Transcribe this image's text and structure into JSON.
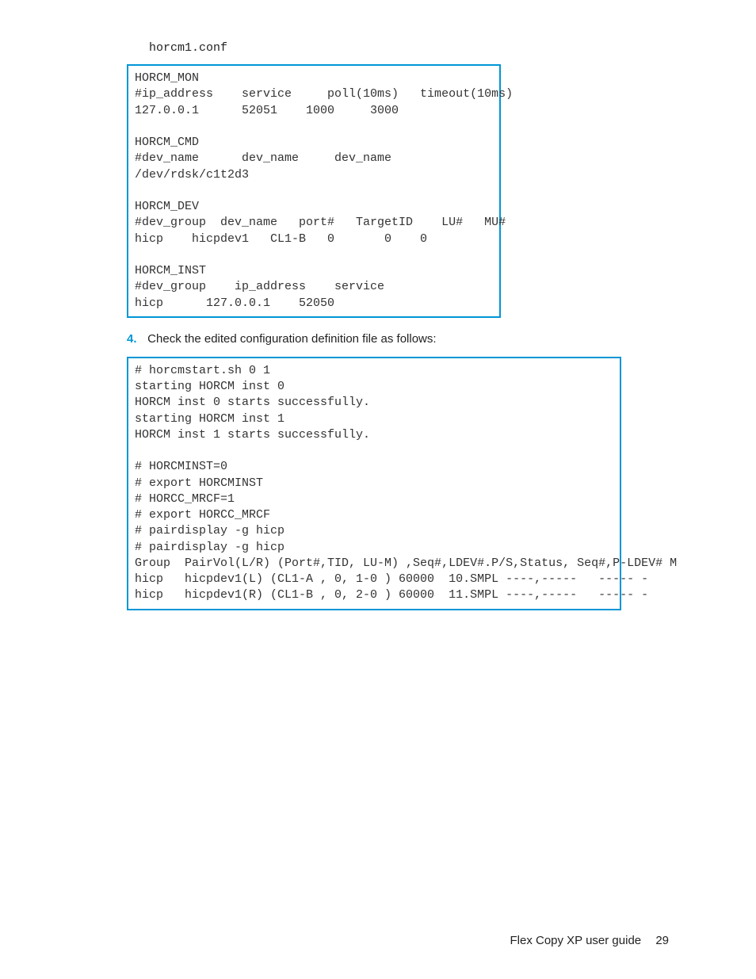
{
  "file_label": "horcm1.conf",
  "code_block_1": "HORCM_MON\n#ip_address    service     poll(10ms)   timeout(10ms)\n127.0.0.1      52051    1000     3000\n\nHORCM_CMD\n#dev_name      dev_name     dev_name\n/dev/rdsk/c1t2d3\n\nHORCM_DEV\n#dev_group  dev_name   port#   TargetID    LU#   MU#\nhicp    hicpdev1   CL1-B   0       0    0\n\nHORCM_INST\n#dev_group    ip_address    service\nhicp      127.0.0.1    52050",
  "step": {
    "number": "4.",
    "text": "Check the edited configuration definition file as follows:"
  },
  "code_block_2": "# horcmstart.sh 0 1 \nstarting HORCM inst 0\nHORCM inst 0 starts successfully.\nstarting HORCM inst 1\nHORCM inst 1 starts successfully.\n\n# HORCMINST=0\n# export HORCMINST\n# HORCC_MRCF=1\n# export HORCC_MRCF\n# pairdisplay -g hicp\n# pairdisplay -g hicp \nGroup  PairVol(L/R) (Port#,TID, LU-M) ,Seq#,LDEV#.P/S,Status, Seq#,P-LDEV# M\nhicp   hicpdev1(L) (CL1-A , 0, 1-0 ) 60000  10.SMPL ----,-----   ----- -\nhicp   hicpdev1(R) (CL1-B , 0, 2-0 ) 60000  11.SMPL ----,-----   ----- -",
  "footer": {
    "title": "Flex Copy XP user guide",
    "page": "29"
  }
}
